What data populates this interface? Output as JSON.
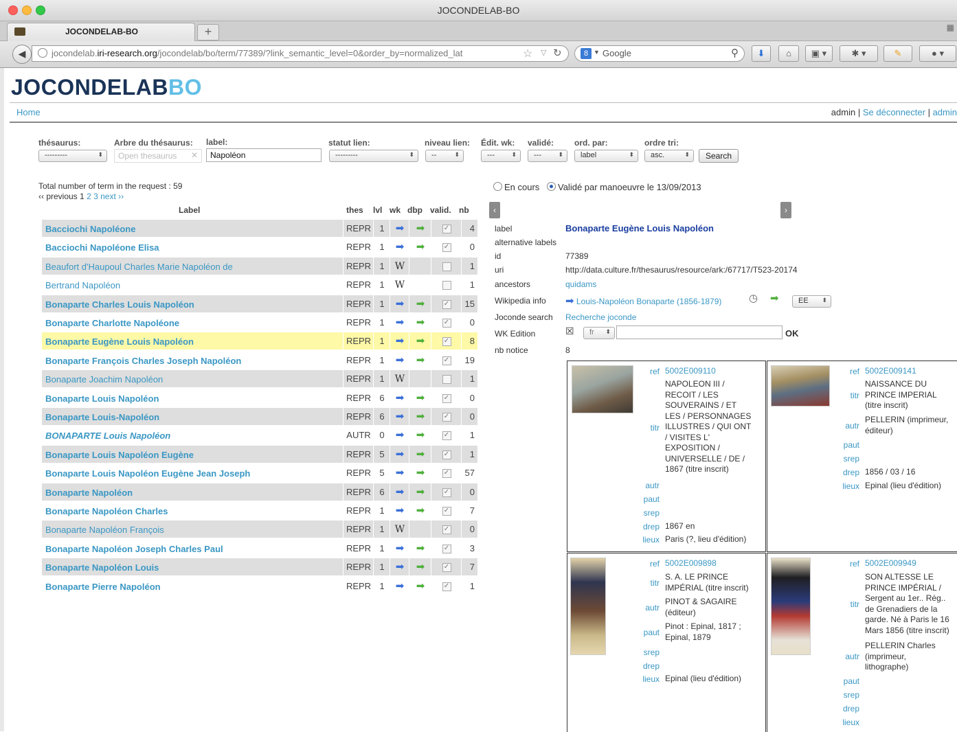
{
  "window": {
    "title": "JOCONDELAB-BO"
  },
  "tab": {
    "label": "JOCONDELAB-BO",
    "new_tab": "+"
  },
  "navbar": {
    "url_domain_pre": "jocondelab.",
    "url_domain": "iri-research.org",
    "url_path": "/jocondelab/bo/term/77389/?link_semantic_level=0&order_by=normalized_lat",
    "search_engine": "Google"
  },
  "header": {
    "logo_a": "JOCONDELAB",
    "logo_b": "BO",
    "home": "Home",
    "user": "admin",
    "sep": "|",
    "logout": "Se déconnecter",
    "admin": "admin"
  },
  "filters": {
    "thesaurus_label": "thésaurus:",
    "thesaurus_value": "---------",
    "tree_label": "Arbre du thésaurus:",
    "tree_placeholder": "Open thesaurus",
    "label_label": "label:",
    "label_value": "Napoléon",
    "statut_label": "statut lien:",
    "statut_value": "---------",
    "niveau_label": "niveau lien:",
    "niveau_value": "--",
    "editwk_label": "Édit. wk:",
    "editwk_value": "---",
    "valide_label": "validé:",
    "valide_value": "---",
    "ordpar_label": "ord. par:",
    "ordpar_value": "label",
    "ordretri_label": "ordre tri:",
    "ordretri_value": "asc.",
    "search_button": "Search"
  },
  "results": {
    "total": "Total number of term in the request : 59",
    "pager_prev": "‹‹ previous",
    "pages": [
      "1",
      "2",
      "3"
    ],
    "pager_next": "next ››",
    "columns": [
      "Label",
      "thes",
      "lvl",
      "wk",
      "dbp",
      "valid.",
      "nb"
    ],
    "rows": [
      {
        "label": "Bacciochi Napoléone",
        "thes": "REPR",
        "lvl": "1",
        "nb": "4",
        "wk": "arrow",
        "dbp": true,
        "valid": true,
        "style": "bold"
      },
      {
        "label": "Bacciochi Napoléone Elisa",
        "thes": "REPR",
        "lvl": "1",
        "nb": "0",
        "wk": "arrow",
        "dbp": true,
        "valid": true,
        "style": "bold"
      },
      {
        "label": "Beaufort d'Haupoul Charles Marie Napoléon de",
        "thes": "REPR",
        "lvl": "1",
        "nb": "1",
        "wk": "wiki",
        "dbp": false,
        "valid": false,
        "style": "normal"
      },
      {
        "label": "Bertrand Napoléon",
        "thes": "REPR",
        "lvl": "1",
        "nb": "1",
        "wk": "wiki",
        "dbp": false,
        "valid": false,
        "style": "normal"
      },
      {
        "label": "Bonaparte Charles Louis Napoléon",
        "thes": "REPR",
        "lvl": "1",
        "nb": "15",
        "wk": "arrow",
        "dbp": true,
        "valid": true,
        "style": "bold"
      },
      {
        "label": "Bonaparte Charlotte Napoléone",
        "thes": "REPR",
        "lvl": "1",
        "nb": "0",
        "wk": "arrow",
        "dbp": true,
        "valid": true,
        "style": "bold"
      },
      {
        "label": "Bonaparte Eugène Louis Napoléon",
        "thes": "REPR",
        "lvl": "1",
        "nb": "8",
        "wk": "arrow",
        "dbp": true,
        "valid": true,
        "style": "bold",
        "selected": true
      },
      {
        "label": "Bonaparte François Charles Joseph Napoléon",
        "thes": "REPR",
        "lvl": "1",
        "nb": "19",
        "wk": "arrow",
        "dbp": true,
        "valid": true,
        "style": "bold"
      },
      {
        "label": "Bonaparte Joachim Napoléon",
        "thes": "REPR",
        "lvl": "1",
        "nb": "1",
        "wk": "wiki",
        "dbp": false,
        "valid": false,
        "style": "normal"
      },
      {
        "label": "Bonaparte Louis Napoléon",
        "thes": "REPR",
        "lvl": "6",
        "nb": "0",
        "wk": "arrow",
        "dbp": true,
        "valid": true,
        "style": "bold"
      },
      {
        "label": "Bonaparte Louis-Napoléon",
        "thes": "REPR",
        "lvl": "6",
        "nb": "0",
        "wk": "arrow",
        "dbp": true,
        "valid": true,
        "style": "bold"
      },
      {
        "label": "BONAPARTE Louis Napoléon",
        "thes": "AUTR",
        "lvl": "0",
        "nb": "1",
        "wk": "arrow",
        "dbp": true,
        "valid": true,
        "style": "bolditalic"
      },
      {
        "label": "Bonaparte Louis Napoléon Eugène",
        "thes": "REPR",
        "lvl": "5",
        "nb": "1",
        "wk": "arrow",
        "dbp": true,
        "valid": true,
        "style": "bold"
      },
      {
        "label": "Bonaparte Louis Napoléon Eugène Jean Joseph",
        "thes": "REPR",
        "lvl": "5",
        "nb": "57",
        "wk": "arrow",
        "dbp": true,
        "valid": true,
        "style": "bold"
      },
      {
        "label": "Bonaparte Napoléon",
        "thes": "REPR",
        "lvl": "6",
        "nb": "0",
        "wk": "arrow",
        "dbp": true,
        "valid": true,
        "style": "bold"
      },
      {
        "label": "Bonaparte Napoléon Charles",
        "thes": "REPR",
        "lvl": "1",
        "nb": "7",
        "wk": "arrow",
        "dbp": true,
        "valid": true,
        "style": "bold"
      },
      {
        "label": "Bonaparte Napoléon François",
        "thes": "REPR",
        "lvl": "1",
        "nb": "0",
        "wk": "wiki",
        "dbp": false,
        "valid": true,
        "style": "normal"
      },
      {
        "label": "Bonaparte Napoléon Joseph Charles Paul",
        "thes": "REPR",
        "lvl": "1",
        "nb": "3",
        "wk": "arrow",
        "dbp": true,
        "valid": true,
        "style": "bold"
      },
      {
        "label": "Bonaparte Napoléon Louis",
        "thes": "REPR",
        "lvl": "1",
        "nb": "7",
        "wk": "arrow",
        "dbp": true,
        "valid": true,
        "style": "bold"
      },
      {
        "label": "Bonaparte Pierre Napoléon",
        "thes": "REPR",
        "lvl": "1",
        "nb": "1",
        "wk": "arrow",
        "dbp": true,
        "valid": true,
        "style": "bold"
      }
    ]
  },
  "detail": {
    "radio_en_cours": "En cours",
    "radio_valide": "Validé par manoeuvre le 13/09/2013",
    "label_key": "label",
    "label_value": "Bonaparte Eugène Louis Napoléon",
    "altlabels_key": "alternative labels",
    "id_key": "id",
    "id_value": "77389",
    "uri_key": "uri",
    "uri_value": "http://data.culture.fr/thesaurus/resource/ark:/67717/T523-20174",
    "ancestors_key": "ancestors",
    "ancestors_value": "quidams",
    "wiki_key": "Wikipedia info",
    "wiki_value": "Louis-Napoléon Bonaparte (1856-1879)",
    "wiki_select": "EE",
    "joconde_key": "Joconde search",
    "joconde_value": "Recherche joconde",
    "wkedit_key": "WK Edition",
    "wkedit_lang": "fr",
    "wkedit_ok": "OK",
    "nbnotice_key": "nb notice",
    "nbnotice_value": "8"
  },
  "card_keys": {
    "ref": "ref",
    "titr": "titr",
    "autr": "autr",
    "paut": "paut",
    "srep": "srep",
    "drep": "drep",
    "lieux": "lieux"
  },
  "cards": [
    {
      "ref": "5002E009110",
      "titr": "NAPOLEON III / RECOIT / LES SOUVERAINS / ET LES / PERSONNAGES ILLUSTRES / QUI ONT / VISITES L' EXPOSITION / UNIVERSELLE / DE / 1867 (titre inscrit)",
      "titr_lines": [
        "NAPOLEON III /",
        "RECOIT / LES",
        "SOUVERAINS / ET",
        "LES / PERSONNAGES",
        "ILLUSTRES / QUI ONT",
        "/ VISITES L'",
        "EXPOSITION /",
        "UNIVERSELLE / DE /",
        "1867 (titre inscrit)"
      ],
      "autr": "",
      "paut": "",
      "srep": "",
      "drep": "1867 en",
      "lieux": "Paris (?, lieu d'édition)"
    },
    {
      "ref": "5002E009141",
      "titr_lines": [
        "NAISSANCE DU",
        "PRINCE IMPERIAL",
        "(titre inscrit)"
      ],
      "autr_lines": [
        "PELLERIN (imprimeur,",
        "éditeur)"
      ],
      "paut": "",
      "srep": "",
      "drep": "1856 / 03 / 16",
      "lieux": "Epinal (lieu d'édition)"
    },
    {
      "ref": "5002E009898",
      "titr_lines": [
        "S. A. LE PRINCE",
        "IMPÉRIAL (titre inscrit)"
      ],
      "autr_lines": [
        "PINOT & SAGAIRE",
        "(éditeur)"
      ],
      "paut_lines": [
        "Pinot : Epinal, 1817 ;",
        "Epinal, 1879"
      ],
      "srep": "",
      "drep": "",
      "lieux": "Epinal (lieu d'édition)"
    },
    {
      "ref": "5002E009949",
      "titr_lines": [
        "SON ALTESSE LE",
        "PRINCE IMPÉRIAL /",
        "Sergent au 1er.. Rég..",
        "de Grenadiers de la",
        "garde. Né à Paris le 16",
        "Mars 1856 (titre inscrit)"
      ],
      "autr_lines": [
        "PELLERIN Charles",
        "(imprimeur,",
        "lithographe)"
      ],
      "paut": "",
      "srep": "",
      "drep": "",
      "lieux": ""
    }
  ]
}
